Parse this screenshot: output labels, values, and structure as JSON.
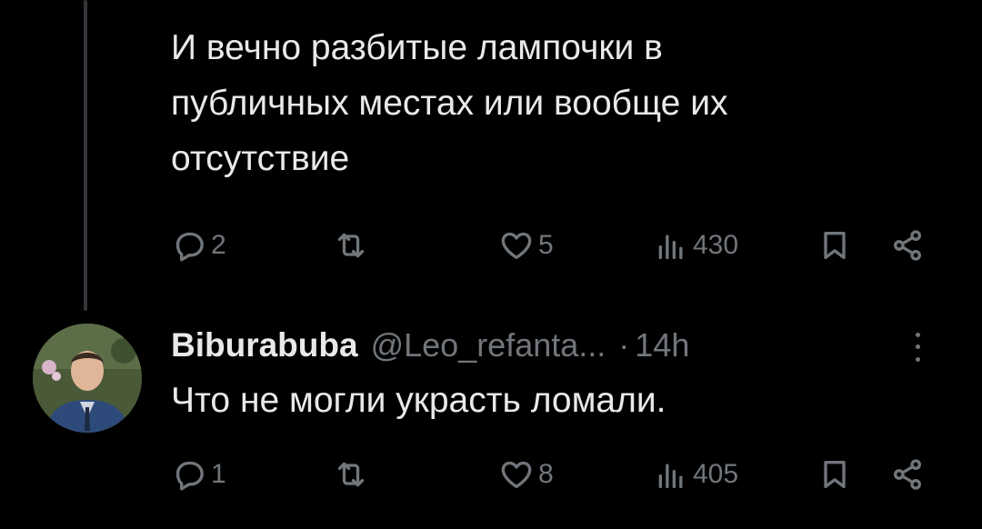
{
  "tweets": [
    {
      "text": "И вечно разбитые лампочки в\nпубличных местах или вообще их\nотсутствие",
      "actions": {
        "replies": "2",
        "retweets": "",
        "likes": "5",
        "views": "430"
      }
    },
    {
      "author": {
        "display_name": "Biburabuba",
        "handle": "@Leo_refanta...",
        "time": "14h"
      },
      "separator": "·",
      "text": "Что не могли украсть ломали.",
      "actions": {
        "replies": "1",
        "retweets": "",
        "likes": "8",
        "views": "405"
      }
    }
  ],
  "icons": {
    "reply": "reply-icon",
    "retweet": "retweet-icon",
    "like": "heart-icon",
    "views": "views-icon",
    "bookmark": "bookmark-icon",
    "share": "share-icon",
    "more": "more-icon"
  },
  "colors": {
    "background": "#000000",
    "text": "#e7e9ea",
    "secondary": "#71767b",
    "thread_line": "#333639"
  }
}
